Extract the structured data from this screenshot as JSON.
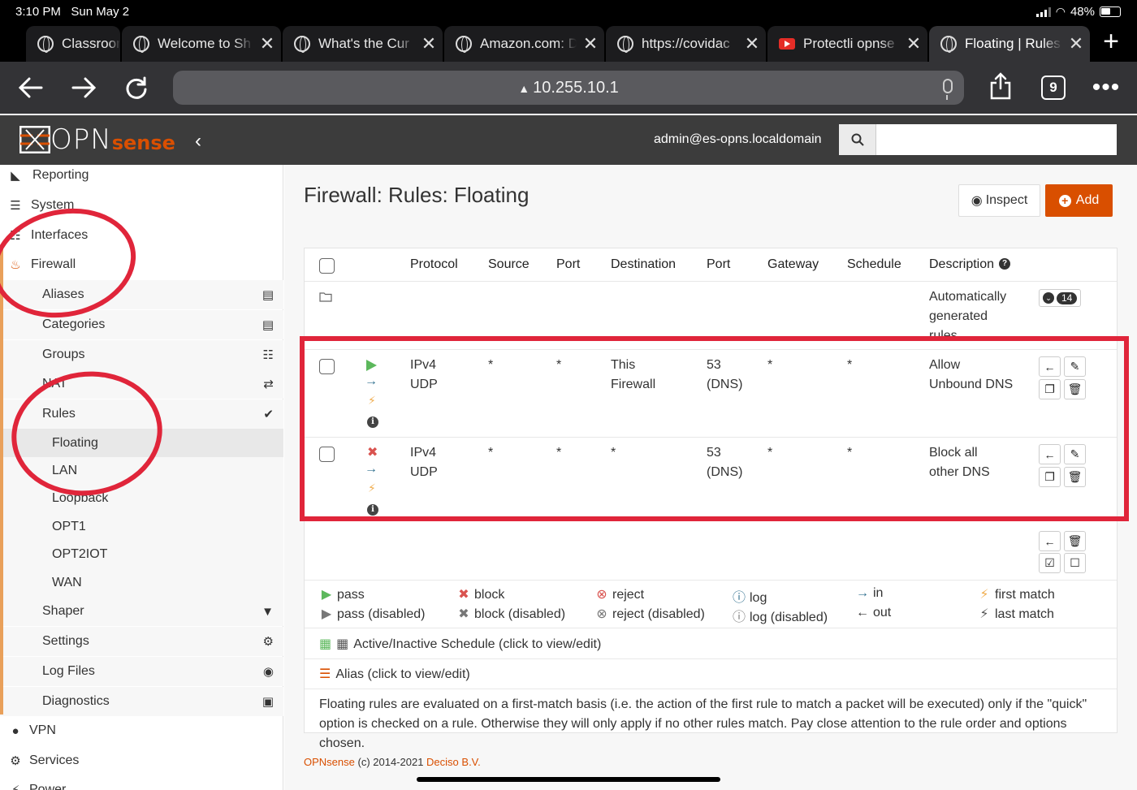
{
  "status_bar": {
    "time": "3:10 PM",
    "date": "Sun May 2",
    "battery": "48%"
  },
  "browser": {
    "tabs": [
      {
        "title": "Classroom",
        "icon": "globe-icon",
        "active": false
      },
      {
        "title": "Welcome to Sh",
        "icon": "globe-icon",
        "active": false
      },
      {
        "title": "What's the Cur",
        "icon": "globe-icon",
        "active": false
      },
      {
        "title": "Amazon.com: D",
        "icon": "globe-icon",
        "active": false
      },
      {
        "title": "https://covidac",
        "icon": "globe-icon",
        "active": false
      },
      {
        "title": "Protectli opnse",
        "icon": "youtube-icon",
        "active": false
      },
      {
        "title": "Floating | Rules",
        "icon": "globe-icon",
        "active": true
      }
    ],
    "url": "10.255.10.1",
    "tab_count": "9"
  },
  "app": {
    "logo_text": "OPN",
    "logo_sense": "sense",
    "user": "admin@es-opns.localdomain",
    "search_value": ""
  },
  "sidebar": {
    "items": [
      {
        "label": "Reporting",
        "icon": "chart-icon"
      },
      {
        "label": "System",
        "icon": "server-icon"
      },
      {
        "label": "Interfaces",
        "icon": "sitemap-icon"
      },
      {
        "label": "Firewall",
        "icon": "fire-icon"
      },
      {
        "label": "Aliases",
        "icon": "list-icon"
      },
      {
        "label": "Categories",
        "icon": "list-icon"
      },
      {
        "label": "Groups",
        "icon": "sitemap-icon"
      },
      {
        "label": "NAT",
        "icon": "exchange-icon"
      },
      {
        "label": "Rules",
        "icon": "check-icon"
      },
      {
        "label": "Floating"
      },
      {
        "label": "LAN"
      },
      {
        "label": "Loopback"
      },
      {
        "label": "OPT1"
      },
      {
        "label": "OPT2IOT"
      },
      {
        "label": "WAN"
      },
      {
        "label": "Shaper",
        "icon": "filter-icon"
      },
      {
        "label": "Settings",
        "icon": "cogs-icon"
      },
      {
        "label": "Log Files",
        "icon": "eye-icon"
      },
      {
        "label": "Diagnostics",
        "icon": "medkit-icon"
      },
      {
        "label": "VPN",
        "icon": "globe-icon"
      },
      {
        "label": "Services",
        "icon": "cog-icon"
      },
      {
        "label": "Power",
        "icon": "plug-icon"
      }
    ]
  },
  "page": {
    "title": "Firewall: Rules: Floating",
    "inspect_label": "Inspect",
    "add_label": "Add"
  },
  "table": {
    "headers": [
      "Protocol",
      "Source",
      "Port",
      "Destination",
      "Port",
      "Gateway",
      "Schedule",
      "Description"
    ],
    "auto_row": {
      "description": "Automatically generated rules",
      "count": "14"
    },
    "rows": [
      {
        "action": "pass",
        "protocol_1": "IPv4",
        "protocol_2": "UDP",
        "source": "*",
        "source_port": "*",
        "dest_1": "This",
        "dest_2": "Firewall",
        "dest_port_1": "53",
        "dest_port_2": "(DNS)",
        "gateway": "*",
        "schedule": "*",
        "desc_1": "Allow",
        "desc_2": "Unbound DNS"
      },
      {
        "action": "block",
        "protocol_1": "IPv4",
        "protocol_2": "UDP",
        "source": "*",
        "source_port": "*",
        "dest_1": "*",
        "dest_2": "",
        "dest_port_1": "53",
        "dest_port_2": "(DNS)",
        "gateway": "*",
        "schedule": "*",
        "desc_1": "Block all",
        "desc_2": "other DNS"
      }
    ]
  },
  "legend": {
    "pass": "pass",
    "pass_disabled": "pass (disabled)",
    "block": "block",
    "block_disabled": "block (disabled)",
    "reject": "reject",
    "reject_disabled": "reject (disabled)",
    "log": "log",
    "log_disabled": "log (disabled)",
    "in": "in",
    "out": "out",
    "first_match": "first match",
    "last_match": "last match",
    "schedule": "Active/Inactive Schedule (click to view/edit)",
    "alias": "Alias (click to view/edit)"
  },
  "note_1": "Floating rules are evaluated on a first-match basis (i.e. the action of the first rule to match a packet will be executed) only if the \"quick\"",
  "note_2": "option is checked on a rule. Otherwise they will only apply if no other rules match. Pay close attention to the rule order and options chosen.",
  "footer": {
    "brand": "OPNsense",
    "copy": " (c) 2014-2021 ",
    "company": "Deciso B.V."
  },
  "colors": {
    "accent": "#d94f00",
    "annotation": "#e0253a",
    "pass": "#5cb85c",
    "block": "#d9534f",
    "info": "#31708f"
  }
}
